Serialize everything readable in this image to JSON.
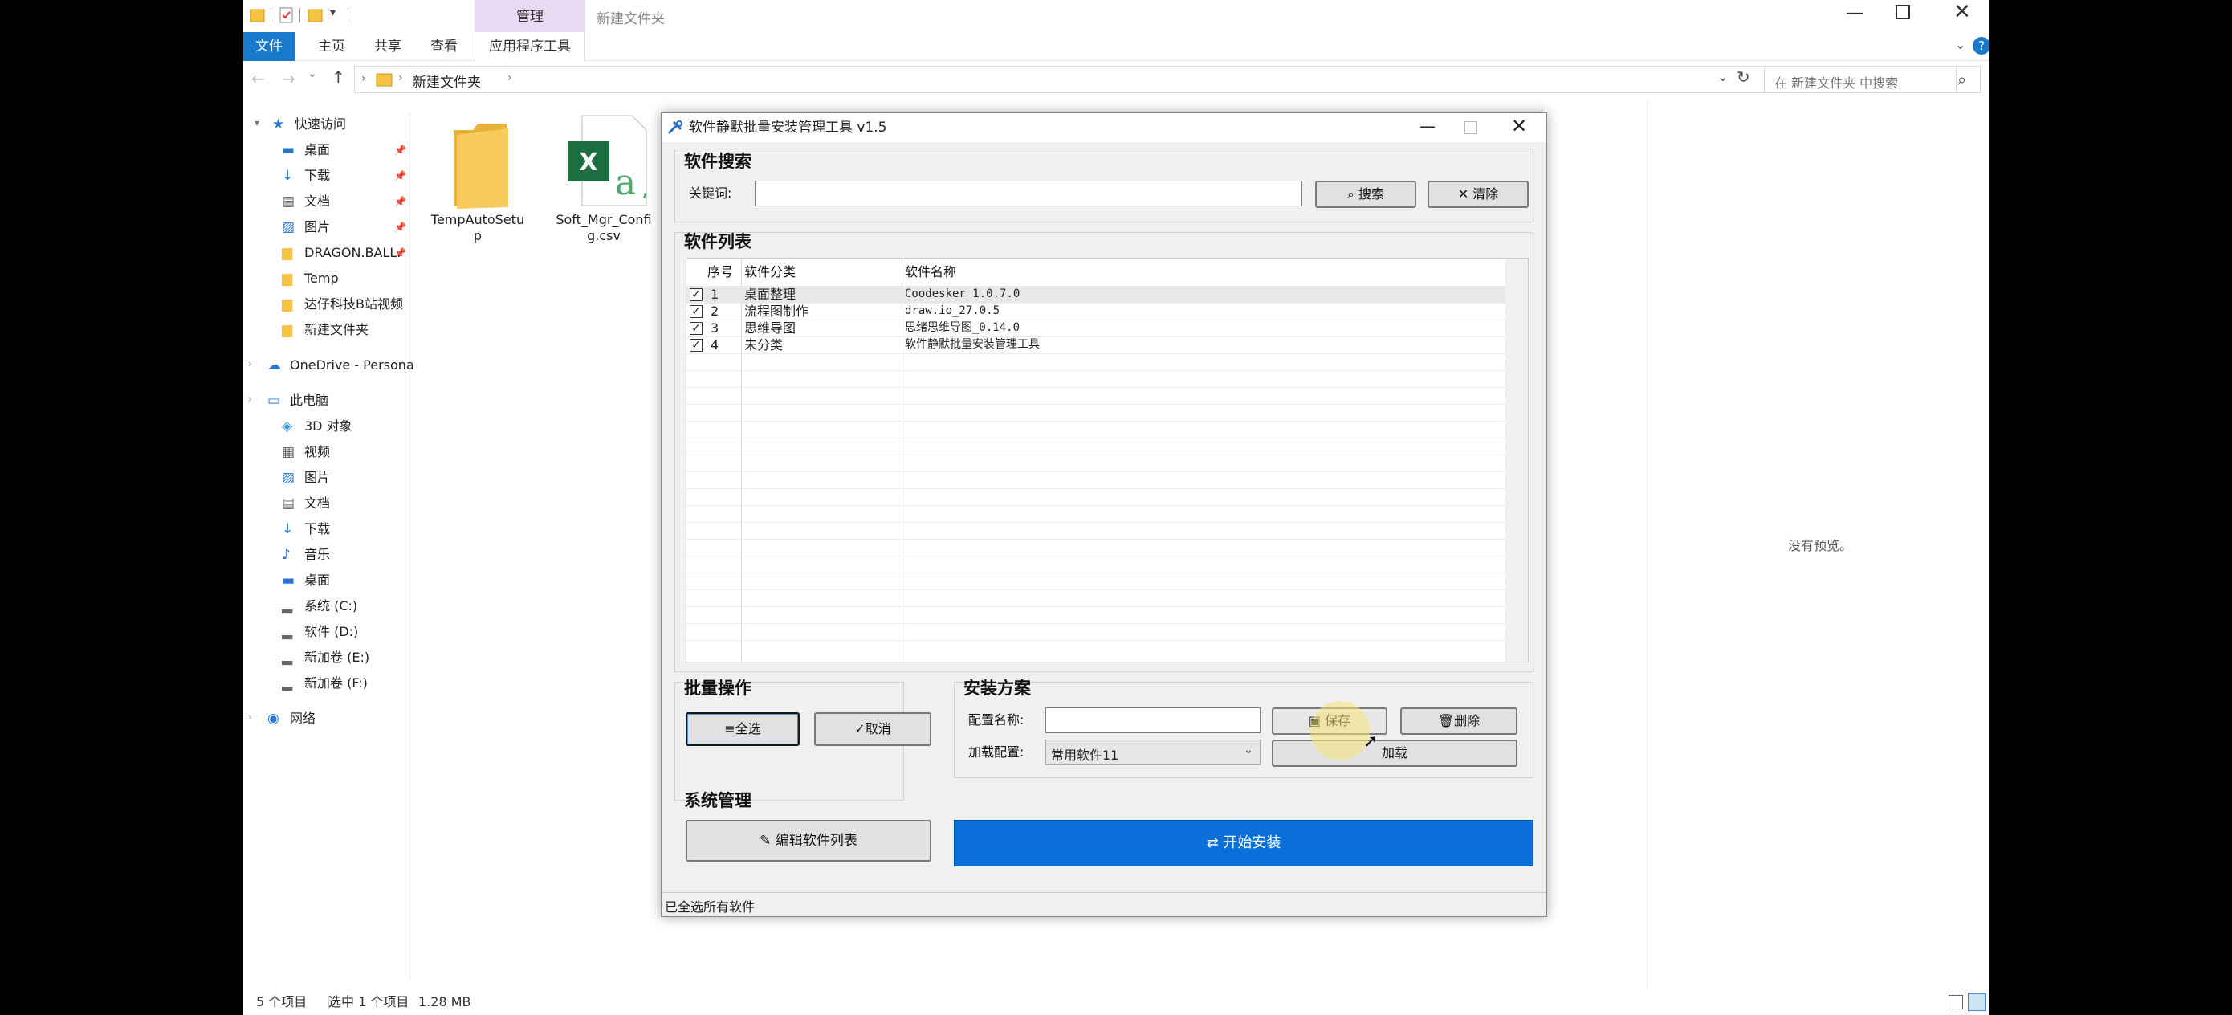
{
  "explorer": {
    "title": "新建文件夹",
    "context_tab": "管理",
    "ribbon_tabs": [
      "文件",
      "主页",
      "共享",
      "查看",
      "应用程序工具"
    ],
    "breadcrumb": "新建文件夹",
    "search_placeholder": "在 新建文件夹 中搜索",
    "nav_items": [
      {
        "label": "快速访问",
        "icon": "star-icon",
        "pinned": false
      },
      {
        "label": "桌面",
        "icon": "desktop-icon",
        "pinned": true
      },
      {
        "label": "下载",
        "icon": "download-icon",
        "pinned": true
      },
      {
        "label": "文档",
        "icon": "document-icon",
        "pinned": true
      },
      {
        "label": "图片",
        "icon": "picture-icon",
        "pinned": true
      },
      {
        "label": "DRAGON.BALL.",
        "icon": "folder-icon",
        "pinned": true
      },
      {
        "label": "Temp",
        "icon": "folder-icon",
        "pinned": false
      },
      {
        "label": "达仔科技B站视频",
        "icon": "folder-icon",
        "pinned": false
      },
      {
        "label": "新建文件夹",
        "icon": "folder-icon",
        "pinned": false
      },
      {
        "label": "OneDrive - Persona",
        "icon": "cloud-icon",
        "pinned": false
      },
      {
        "label": "此电脑",
        "icon": "computer-icon",
        "pinned": false
      },
      {
        "label": "3D 对象",
        "icon": "cube-icon",
        "pinned": false
      },
      {
        "label": "视频",
        "icon": "video-icon",
        "pinned": false
      },
      {
        "label": "图片",
        "icon": "picture-icon",
        "pinned": false
      },
      {
        "label": "文档",
        "icon": "document-icon",
        "pinned": false
      },
      {
        "label": "下载",
        "icon": "download-icon",
        "pinned": false
      },
      {
        "label": "音乐",
        "icon": "music-icon",
        "pinned": false
      },
      {
        "label": "桌面",
        "icon": "desktop-icon",
        "pinned": false
      },
      {
        "label": "系统 (C:)",
        "icon": "drive-icon",
        "pinned": false
      },
      {
        "label": "软件 (D:)",
        "icon": "drive-icon",
        "pinned": false
      },
      {
        "label": "新加卷 (E:)",
        "icon": "drive-icon",
        "pinned": false
      },
      {
        "label": "新加卷 (F:)",
        "icon": "drive-icon",
        "pinned": false
      },
      {
        "label": "网络",
        "icon": "network-icon",
        "pinned": false
      }
    ],
    "files": [
      {
        "name_line1": "TempAutoSetu",
        "name_line2": "p",
        "icon": "folder-icon"
      },
      {
        "name_line1": "Soft_Mgr_Confi",
        "name_line2": "g.csv",
        "icon": "excel-icon"
      }
    ],
    "preview_text": "没有预览。",
    "status": {
      "count": "5 个项目",
      "selected": "选中 1 个项目",
      "size": "1.28 MB"
    }
  },
  "app": {
    "title": "软件静默批量安装管理工具 v1.5",
    "search": {
      "section": "软件搜索",
      "keyword_label": "关键词:",
      "keyword_value": "",
      "search_button": "搜索",
      "clear_button": "清除"
    },
    "list": {
      "section": "软件列表",
      "headers": [
        "序号",
        "软件分类",
        "软件名称"
      ],
      "rows": [
        {
          "no": "1",
          "category": "桌面整理",
          "name": "Coodesker_1.0.7.0",
          "checked": true
        },
        {
          "no": "2",
          "category": "流程图制作",
          "name": "draw.io_27.0.5",
          "checked": true
        },
        {
          "no": "3",
          "category": "思维导图",
          "name": "思绪思维导图_0.14.0",
          "checked": true
        },
        {
          "no": "4",
          "category": "未分类",
          "name": "软件静默批量安装管理工具",
          "checked": true
        }
      ]
    },
    "batch": {
      "section": "批量操作",
      "select_all": "全选",
      "cancel": "取消"
    },
    "plan": {
      "section": "安装方案",
      "name_label": "配置名称:",
      "name_value": "",
      "save_button": "保存",
      "delete_button": "删除",
      "load_label": "加载配置:",
      "load_value": "常用软件11",
      "load_button": "加载"
    },
    "system": {
      "section": "系统管理",
      "edit_button": "编辑软件列表",
      "install_button": "开始安装"
    },
    "status_text": "已全选所有软件"
  },
  "colors": {
    "accent": "#0a6fd8",
    "folder": "#f5c342",
    "excel": "#1d6f42",
    "context_tab": "#e9d9f3"
  }
}
